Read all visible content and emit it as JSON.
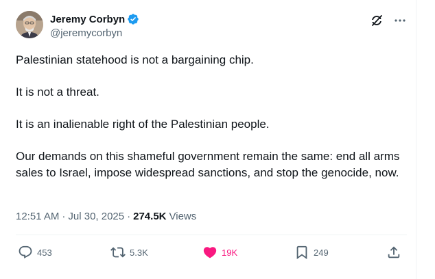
{
  "author": {
    "display_name": "Jeremy Corbyn",
    "handle": "@jeremycorbyn",
    "verified": true,
    "verified_color": "#1d9bf0"
  },
  "tweet": {
    "paragraphs": [
      "Palestinian statehood is not a bargaining chip.",
      "It is not a threat.",
      "It is an inalienable right of the Palestinian people.",
      "Our demands on this shameful government remain the same: end all arms sales to Israel, impose widespread sanctions, and stop the genocide, now."
    ],
    "time": "12:51 AM",
    "date": "Jul 30, 2025",
    "dot": "·",
    "views_count": "274.5K",
    "views_label": "Views"
  },
  "actions": {
    "replies": "453",
    "retweets": "5.3K",
    "likes": "19K",
    "bookmarks": "249"
  },
  "icons": {
    "avatar": "avatar-photo",
    "verified": "verified-badge-icon",
    "grok": "grok-icon",
    "more": "more-icon",
    "reply": "reply-icon",
    "retweet": "retweet-icon",
    "like": "heart-icon",
    "bookmark": "bookmark-icon",
    "share": "share-icon"
  },
  "colors": {
    "text": "#0f1419",
    "secondary": "#536471",
    "like_active": "#f91880",
    "divider": "#eff3f4"
  }
}
